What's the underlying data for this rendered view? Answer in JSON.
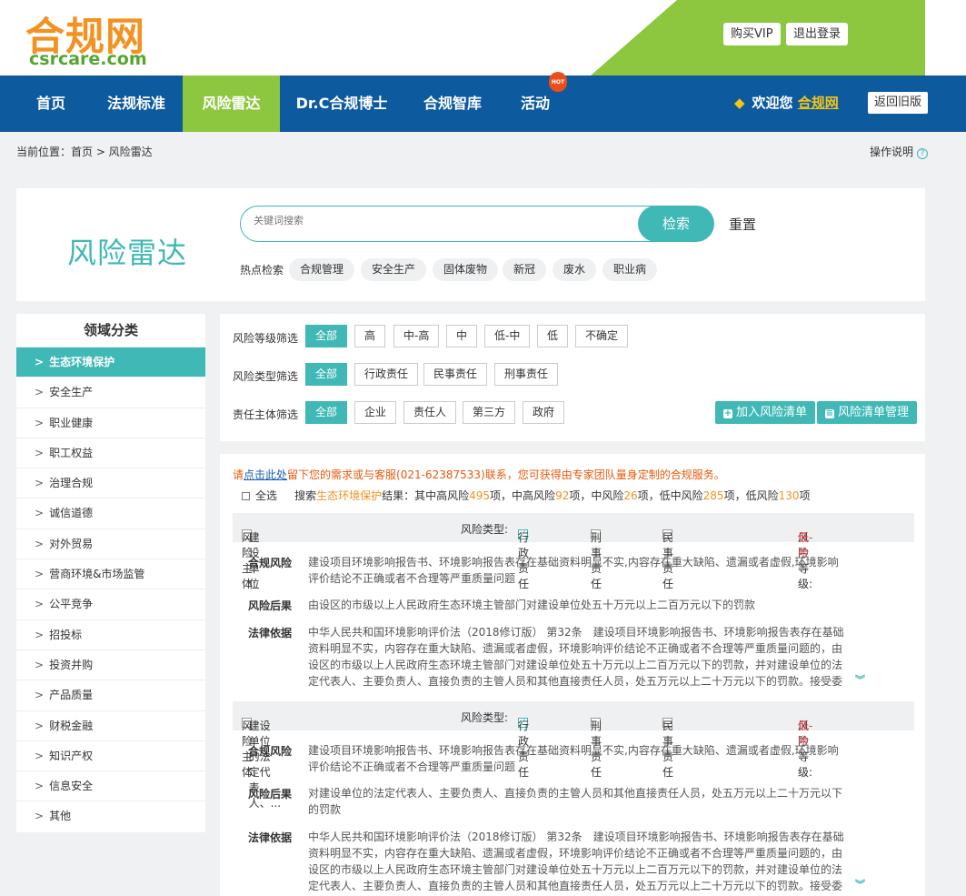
{
  "header": {
    "logo_cn": "合规网",
    "logo_en": "csrcare.com",
    "buy_vip": "购买VIP",
    "logout": "退出登录"
  },
  "nav": {
    "items": [
      "首页",
      "法规标准",
      "风险雷达",
      "Dr.C合规博士",
      "合规智库",
      "活动"
    ],
    "hot_badge": "HOT",
    "welcome": "欢迎您",
    "user": "合规网",
    "old_version": "返回旧版"
  },
  "breadcrumb": {
    "text": "当前位置：首页 > 风险雷达",
    "help": "操作说明"
  },
  "search": {
    "title": "风险雷达",
    "placeholder": "关键词搜索",
    "button": "检索",
    "reset": "重置",
    "hot_label": "热点检索",
    "hot_tags": [
      "合规管理",
      "安全生产",
      "固体废物",
      "新冠",
      "废水",
      "职业病"
    ]
  },
  "sidebar": {
    "title": "领域分类",
    "items": [
      "生态环境保护",
      "安全生产",
      "职业健康",
      "职工权益",
      "治理合规",
      "诚信道德",
      "对外贸易",
      "营商环境&市场监管",
      "公平竞争",
      "招投标",
      "投资并购",
      "产品质量",
      "财税金融",
      "知识产权",
      "信息安全",
      "其他"
    ]
  },
  "filters": {
    "level_label": "风险等级筛选",
    "levels": [
      "全部",
      "高",
      "中-高",
      "中",
      "低-中",
      "低",
      "不确定"
    ],
    "type_label": "风险类型筛选",
    "types": [
      "全部",
      "行政责任",
      "民事责任",
      "刑事责任"
    ],
    "subject_label": "责任主体筛选",
    "subjects": [
      "全部",
      "企业",
      "责任人",
      "第三方",
      "政府"
    ],
    "add_list": "加入风险清单",
    "manage_list": "风险清单管理"
  },
  "results": {
    "notice_pre": "请",
    "notice_link": "点击此处",
    "notice_post": "留下您的需求或与客服(021-62387533)联系，您可获得由专家团队量身定制的合规服务。",
    "select_all": "全选",
    "summary_pre": "搜索",
    "summary_domain": "生态环境保护",
    "summary_mid": "结果：其中高风险",
    "count_high": "495",
    "t1": "项，中高风险",
    "count_midhigh": "92",
    "t2": "项，中风险",
    "count_mid": "26",
    "t3": "项，低中风险",
    "count_lowmid": "285",
    "t4": "项，低风险",
    "count_low": "130",
    "t5": "项",
    "cards": [
      {
        "subject_label": "风险主体:",
        "subject": "建设单位",
        "type_label": "风险类型:",
        "type_admin": "行政责任",
        "type_criminal": "刑事责任",
        "type_civil": "民事责任",
        "level_label": "风险等级:",
        "level": "低-中",
        "risk_label": "合规风险",
        "risk": "建设项目环境影响报告书、环境影响报告表存在基础资料明显不实,内容存在重大缺陷、遗漏或者虚假,环境影响评价结论不正确或者不合理等严重质量问题",
        "consequence_label": "风险后果",
        "consequence": "由设区的市级以上人民政府生态环境主管部门对建设单位处五十万元以上二百万元以下的罚款",
        "basis_label": "法律依据",
        "basis": "中华人民共和国环境影响评价法（2018修订版） 第32条　建设项目环境影响报告书、环境影响报告表存在基础资料明显不实，内容存在重大缺陷、遗漏或者虚假，环境影响评价结论不正确或者不合理等严重质量问题的，由设区的市级以上人民政府生态环境主管部门对建设单位处五十万元以上二百万元以下的罚款，并对建设单位的法定代表人、主要负责人、直接负责的主管人员和其他直接责任人员，处五万元以上二十万元以下的罚款。接受委托编制建"
      },
      {
        "subject_label": "风险主体:",
        "subject": "建设单位的法定代表人、...",
        "type_label": "风险类型:",
        "type_admin": "行政责任",
        "type_criminal": "刑事责任",
        "type_civil": "民事责任",
        "level_label": "风险等级:",
        "level": "低-中",
        "risk_label": "合规风险",
        "risk": "建设项目环境影响报告书、环境影响报告表存在基础资料明显不实,内容存在重大缺陷、遗漏或者虚假,环境影响评价结论不正确或者不合理等严重质量问题",
        "consequence_label": "风险后果",
        "consequence": "对建设单位的法定代表人、主要负责人、直接负责的主管人员和其他直接责任人员，处五万元以上二十万元以下的罚款",
        "basis_label": "法律依据",
        "basis": "中华人民共和国环境影响评价法（2018修订版） 第32条　建设项目环境影响报告书、环境影响报告表存在基础资料明显不实，内容存在重大缺陷、遗漏或者虚假，环境影响评价结论不正确或者不合理等严重质量问题的，由设区的市级以上人民政府生态环境主管部门对建设单位处五十万元以上二百万元以下的罚款，并对建设单位的法定代表人、主要负责人、直接负责的主管人员和其他直接责任人员，处五万元以上二十万元以下的罚款。接受委托编制建"
      }
    ]
  }
}
